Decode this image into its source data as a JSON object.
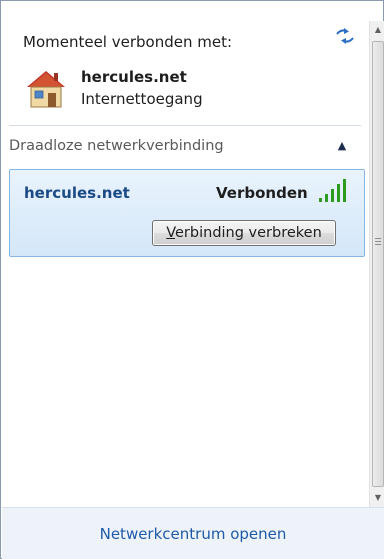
{
  "connection": {
    "title": "Momenteel verbonden met:",
    "network_name": "hercules.net",
    "access": "Internettoegang"
  },
  "section": {
    "title": "Draadloze netwerkverbinding"
  },
  "network": {
    "name": "hercules.net",
    "status": "Verbonden",
    "signal_bars": 5,
    "disconnect_mnemonic": "V",
    "disconnect_rest": "erbinding verbreken"
  },
  "footer": {
    "link": "Netwerkcentrum openen"
  },
  "colors": {
    "accent_link": "#1e5aa8",
    "selection_bg": "#dbeafa",
    "signal_green": "#2e9a1e"
  },
  "icons": {
    "refresh": "refresh-icon",
    "house": "house-icon",
    "collapse": "chevron-up-icon",
    "signal": "signal-strength-icon"
  }
}
